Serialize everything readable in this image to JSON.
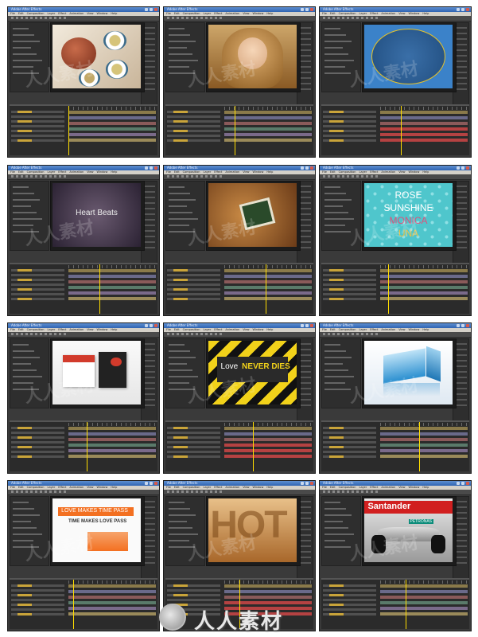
{
  "page": {
    "background": "#ffffff"
  },
  "app": {
    "window_title": "Adobe After Effects",
    "menu_items": [
      "File",
      "Edit",
      "Composition",
      "Layer",
      "Effect",
      "Animation",
      "View",
      "Window",
      "Help"
    ]
  },
  "watermark": {
    "site_text": "人人素材",
    "color": "#e8e8e8"
  },
  "tiles": [
    {
      "id": "tile-teapot",
      "content": "teapot-and-teacups-photo",
      "accent": "#c0392b"
    },
    {
      "id": "tile-woman-portrait",
      "content": "woman-portrait-photo",
      "accent": "#b8860b"
    },
    {
      "id": "tile-blue-oval",
      "content": "blue-oval-frame",
      "accent": "#2c6fb7"
    },
    {
      "id": "tile-heart-beats",
      "content": "text-title",
      "title": "Heart Beats",
      "accent": "#9a7ca0"
    },
    {
      "id": "tile-polaroid",
      "content": "photo-frame-on-grunge",
      "accent": "#a0652a"
    },
    {
      "id": "tile-rose-sunshine",
      "content": "text-title",
      "lines": [
        "ROSE",
        "SUNSHINE",
        "MONICA",
        "UNA"
      ],
      "line_colors": [
        "#ffffff",
        "#ffffff",
        "#e0507a",
        "#f0c040"
      ],
      "accent": "#4fc6cc"
    },
    {
      "id": "tile-promo-cards",
      "content": "product-cards",
      "accent": "#d23b2c"
    },
    {
      "id": "tile-love-never-dies",
      "content": "text-title",
      "title_white": "Love",
      "title_yellow": "NEVER DIES",
      "accent": "#f2d21a"
    },
    {
      "id": "tile-3d-photo-cube",
      "content": "photo-cube",
      "accent": "#3aa3e0"
    },
    {
      "id": "tile-love-makes-time-pass",
      "content": "text-title",
      "headline": "LOVE MAKES TIME PASS",
      "subline": "TIME MAKES LOVE PASS",
      "accent": "#f37021"
    },
    {
      "id": "tile-hot-letters",
      "content": "text-title",
      "title": "HOT",
      "accent": "#d9a24a"
    },
    {
      "id": "tile-f1-car",
      "content": "racing-car-photo",
      "sponsor": "Santander",
      "sponsor_small": "PETRONAS",
      "accent": "#cc1f1f"
    }
  ]
}
